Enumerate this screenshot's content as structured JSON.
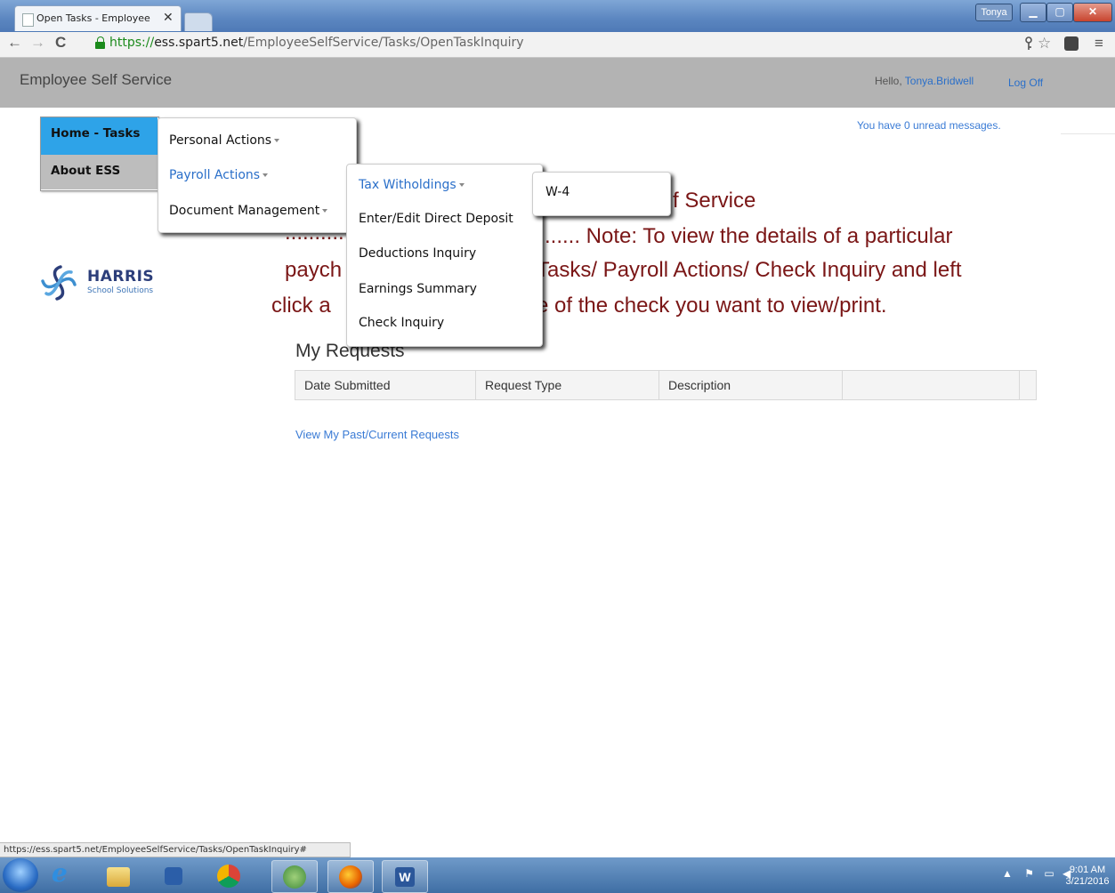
{
  "browser": {
    "tab_title": "Open Tasks - Employee Se",
    "tab_close": "✕",
    "user_badge": "Tonya",
    "window_buttons": {
      "minimize": "▁",
      "maximize": "▢",
      "close": "✕"
    },
    "url_scheme": "https://",
    "url_host": "ess.spart5.net",
    "url_path": "/EmployeeSelfService/Tasks/OpenTaskInquiry",
    "nav_icons": [
      "back-arrow-icon",
      "forward-arrow-icon",
      "reload-icon"
    ]
  },
  "header": {
    "brand": "Employee Self Service",
    "hello_prefix": "Hello, ",
    "user_name": "Tonya.Bridwell",
    "logoff": "Log Off"
  },
  "messages": "You have 0 unread messages.",
  "side_menu": {
    "items": [
      {
        "label": "Home - Tasks",
        "active": true
      },
      {
        "label": "About ESS",
        "active": false
      }
    ]
  },
  "menus": {
    "level1": [
      {
        "label": "Personal Actions",
        "caret": true
      },
      {
        "label": "Payroll Actions",
        "caret": true,
        "active": true
      },
      {
        "label": "Document Management",
        "caret": true
      }
    ],
    "level2": [
      {
        "label": "Tax Witholdings",
        "caret": true,
        "active": true
      },
      {
        "label": "Enter/Edit Direct Deposit"
      },
      {
        "label": "Deductions Inquiry"
      },
      {
        "label": "Earnings Summary"
      },
      {
        "label": "Check Inquiry"
      }
    ],
    "level3": [
      {
        "label": "W-4"
      }
    ]
  },
  "notice": {
    "line0": "f Service",
    "line1_left": "..........",
    "line1_right": "...... Note: To view the details of a particular",
    "line2_left": "paych",
    "line2_right": "Tasks/ Payroll Actions/ Check Inquiry and left",
    "line3_left": "click a",
    "line3_right": "e of the check you want to view/print."
  },
  "logo": {
    "name": "HARRIS",
    "subtitle": "School Solutions"
  },
  "requests": {
    "title": "My Requests",
    "columns": [
      "Date Submitted",
      "Request Type",
      "Description",
      ""
    ],
    "rows": [],
    "link": "View My Past/Current Requests"
  },
  "status_url": "https://ess.spart5.net/EmployeeSelfService/Tasks/OpenTaskInquiry#",
  "taskbar": {
    "apps": [
      "internet-explorer",
      "file-explorer",
      "media-player",
      "chrome",
      "network-app",
      "firefox",
      "word"
    ],
    "time": "9:01 AM",
    "date": "3/21/2016"
  }
}
